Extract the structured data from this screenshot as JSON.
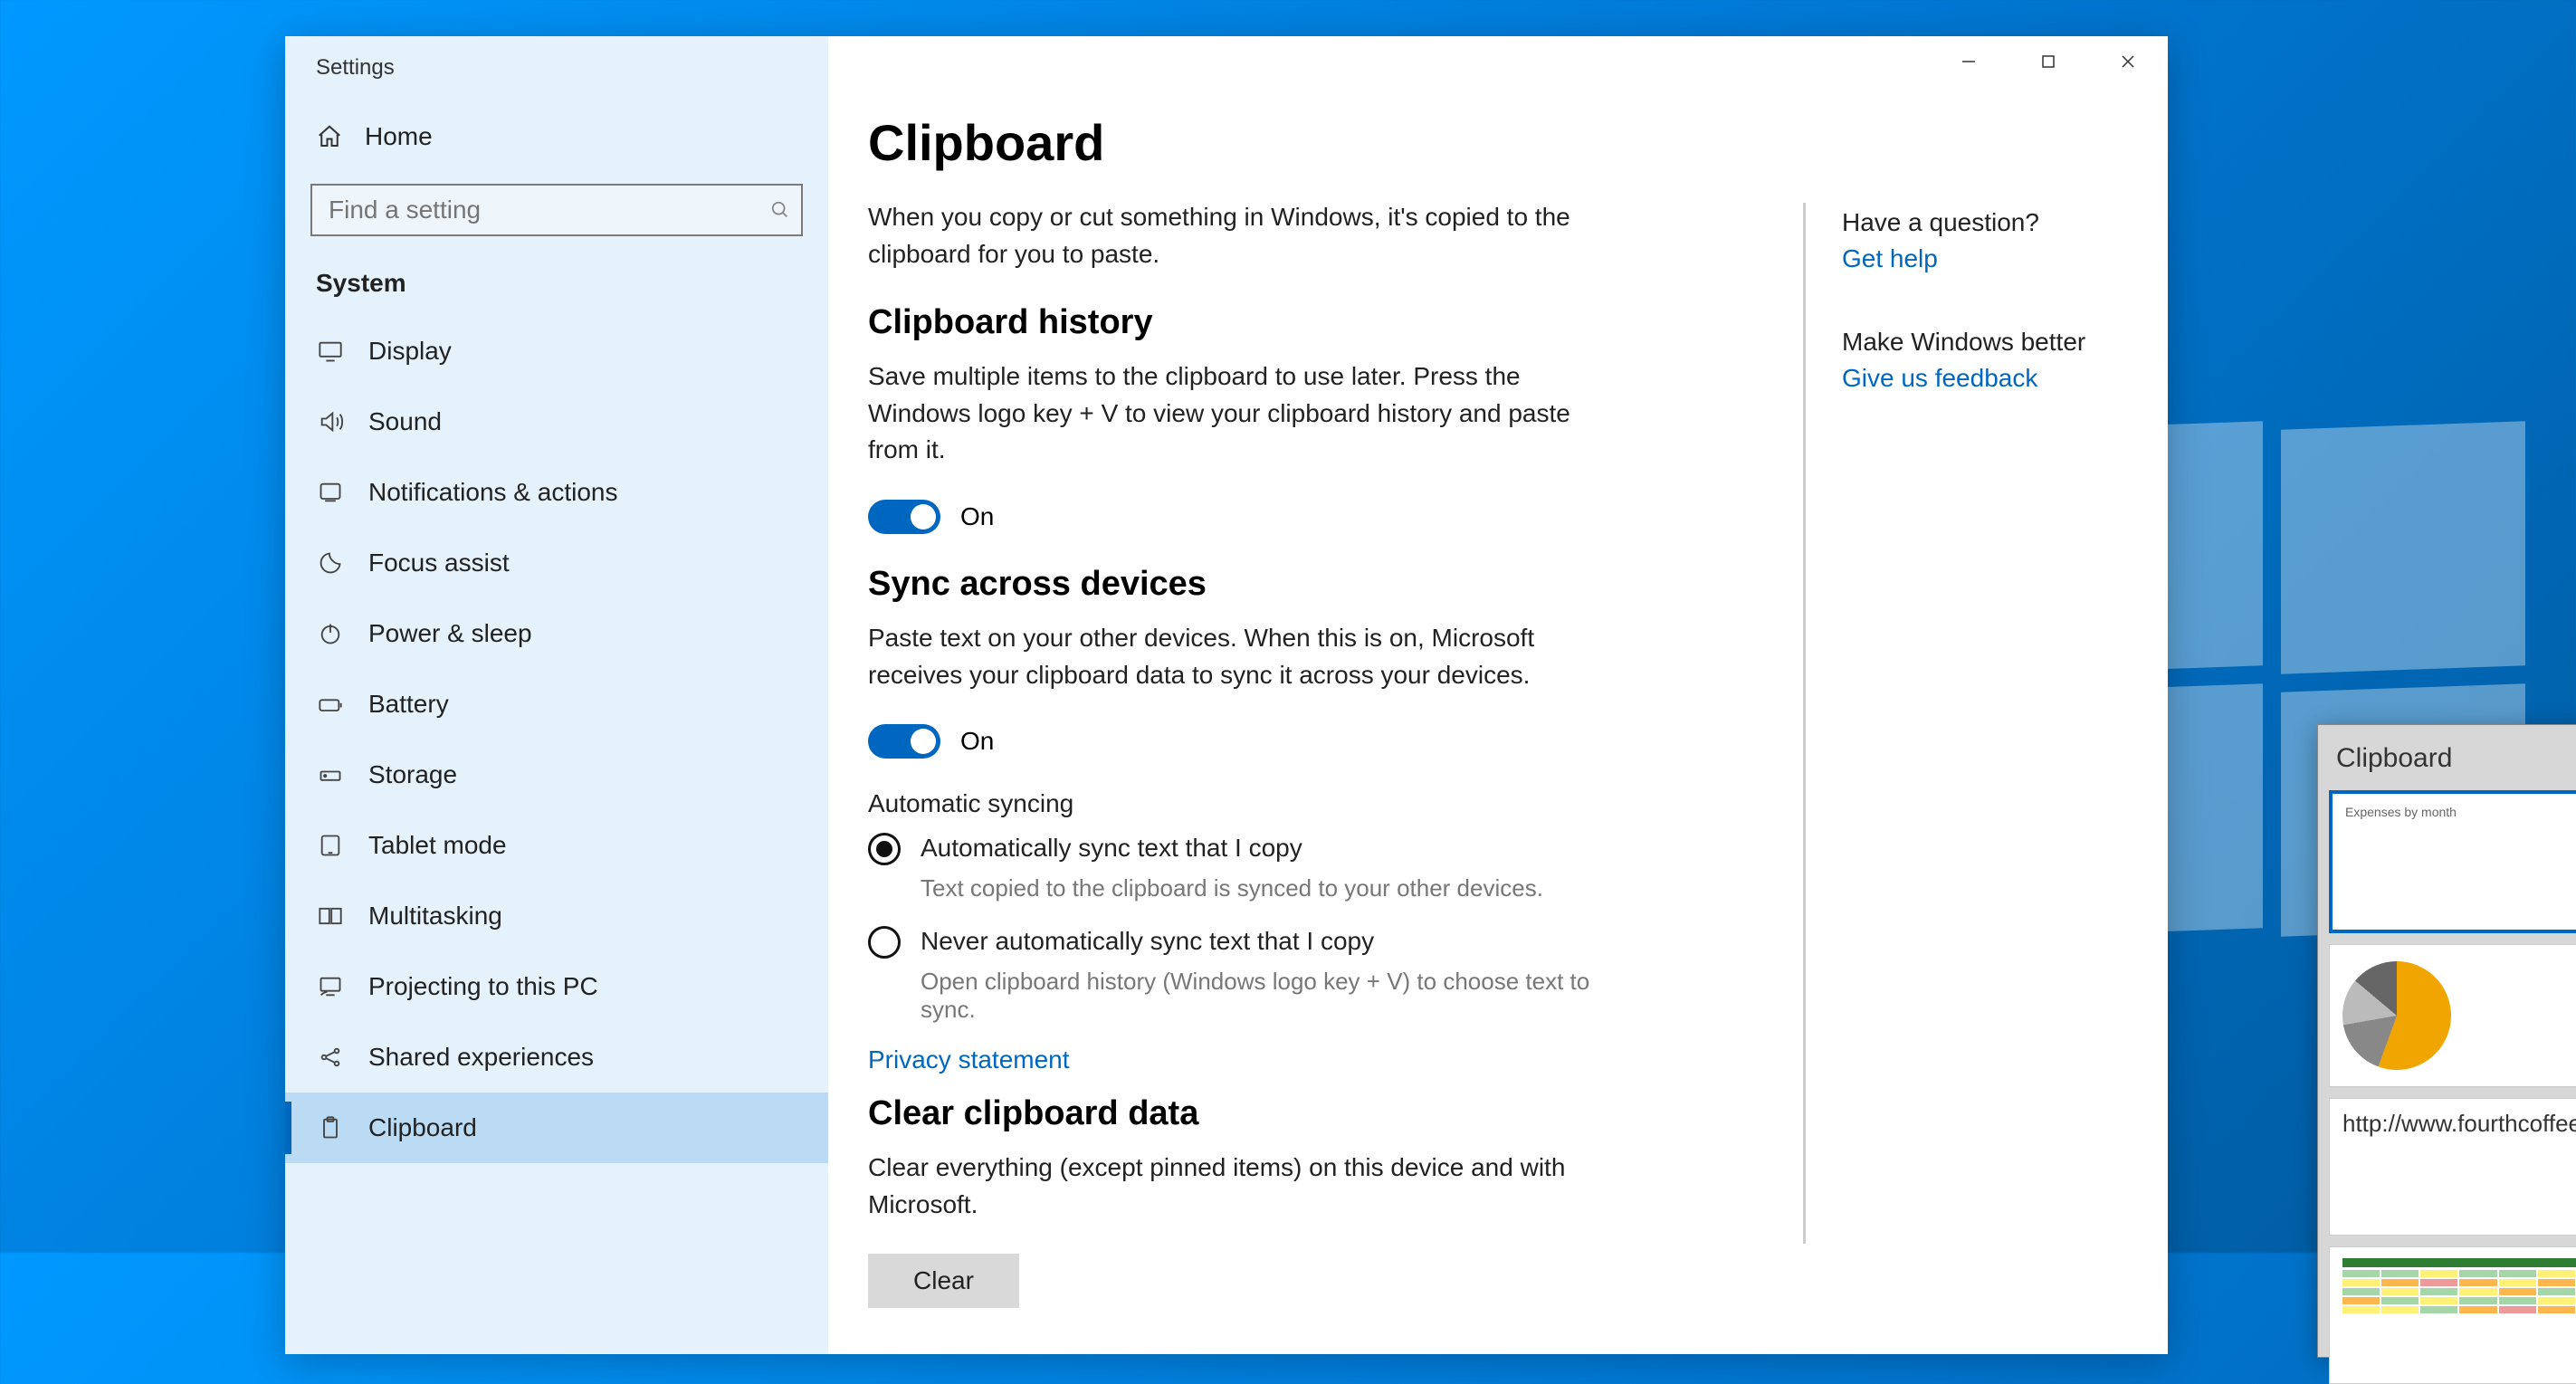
{
  "sidebar": {
    "app_title": "Settings",
    "home_label": "Home",
    "search_placeholder": "Find a setting",
    "section_label": "System",
    "items": [
      {
        "label": "Display"
      },
      {
        "label": "Sound"
      },
      {
        "label": "Notifications & actions"
      },
      {
        "label": "Focus assist"
      },
      {
        "label": "Power & sleep"
      },
      {
        "label": "Battery"
      },
      {
        "label": "Storage"
      },
      {
        "label": "Tablet mode"
      },
      {
        "label": "Multitasking"
      },
      {
        "label": "Projecting to this PC"
      },
      {
        "label": "Shared experiences"
      },
      {
        "label": "Clipboard"
      }
    ]
  },
  "main": {
    "title": "Clipboard",
    "intro": "When you copy or cut something in Windows, it's copied to the clipboard for you to paste.",
    "history_head": "Clipboard history",
    "history_desc": "Save multiple items to the clipboard to use later. Press the Windows logo key + V to view your clipboard history and paste from it.",
    "history_state": "On",
    "sync_head": "Sync across devices",
    "sync_desc": "Paste text on your other devices. When this is on, Microsoft receives your clipboard data to sync it across your devices.",
    "sync_state": "On",
    "auto_label": "Automatic syncing",
    "radio_auto": "Automatically sync text that I copy",
    "radio_auto_sub": "Text copied to the clipboard is synced to your other devices.",
    "radio_never": "Never automatically sync text that I copy",
    "radio_never_sub": "Open clipboard history (Windows logo key + V) to choose text to sync.",
    "privacy_link": "Privacy statement",
    "clear_head": "Clear clipboard data",
    "clear_desc": "Clear everything (except pinned items) on this device and with Microsoft.",
    "clear_btn": "Clear"
  },
  "right": {
    "q_head": "Have a question?",
    "q_link": "Get help",
    "fb_head": "Make Windows better",
    "fb_link": "Give us feedback"
  },
  "flyout": {
    "title": "Clipboard",
    "items": [
      {
        "kind": "barchart"
      },
      {
        "kind": "piechart"
      },
      {
        "kind": "text",
        "text": "http://www.fourthcoffee.com/"
      },
      {
        "kind": "table"
      }
    ]
  },
  "colors": {
    "accent": "#0067c0",
    "chart_orange": "#f0a500"
  }
}
